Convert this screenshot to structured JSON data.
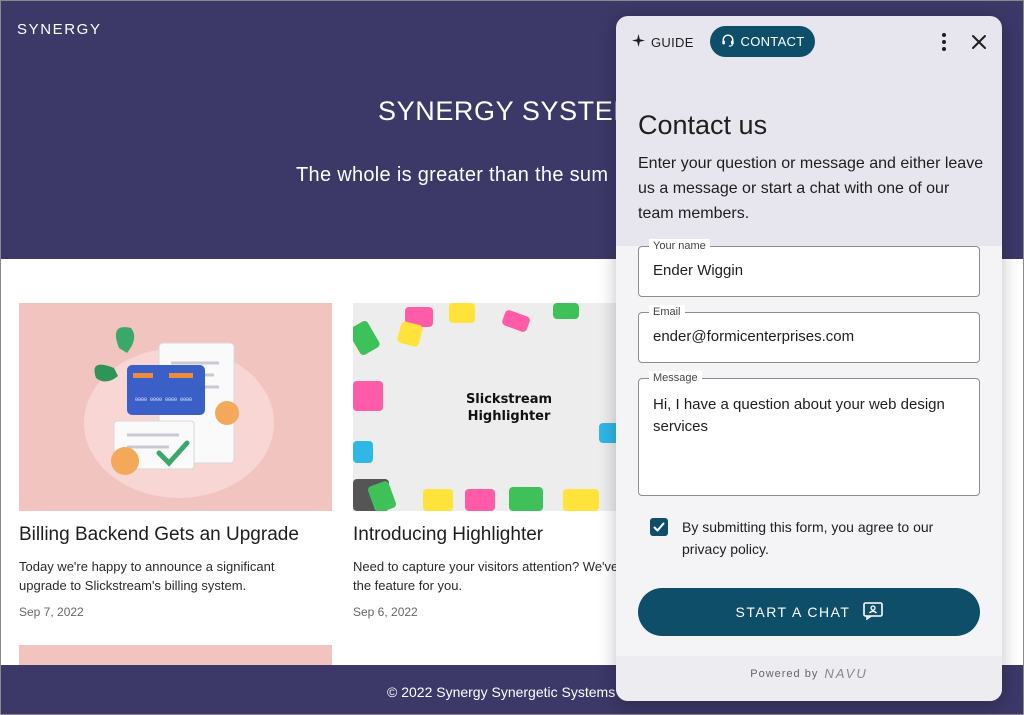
{
  "site": {
    "brand": "SYNERGY",
    "hero_title": "SYNERGY SYSTEMS",
    "hero_subtitle": "The whole is greater than the sum",
    "cards": [
      {
        "image_caption": "",
        "title": "Billing Backend Gets an Upgrade",
        "text_line1": "Today we're happy to announce a significant",
        "text_line2": "upgrade to Slickstream's billing system.",
        "date": "Sep 7, 2022"
      },
      {
        "image_caption": "Slickstream Highlighter",
        "title": "Introducing Highlighter",
        "text_line1": "Need to capture your visitors attention? We've",
        "text_line2": "the feature for you.",
        "date": "Sep 6, 2022"
      }
    ],
    "footer": "© 2022 Synergy Synergetic Systems"
  },
  "panel": {
    "tabs": {
      "guide": "GUIDE",
      "contact": "CONTACT"
    },
    "heading": "Contact us",
    "description": "Enter your question or message and either leave us a message or start a chat with one of our team members.",
    "fields": {
      "name": {
        "label": "Your name",
        "value": "Ender Wiggin"
      },
      "email": {
        "label": "Email",
        "value": "ender@formicenterprises.com"
      },
      "message": {
        "label": "Message",
        "value": "Hi, I have a question about your web design services"
      }
    },
    "consent": {
      "checked": true,
      "text": "By submitting this form, you agree to our privacy policy."
    },
    "start_button": "START A CHAT",
    "powered_by": "Powered by",
    "powered_logo": "NAVU"
  },
  "colors": {
    "hero_bg": "#3c3868",
    "accent": "#0e4e68",
    "card1_bg": "#f2c4c0",
    "card2_bg": "#ededed"
  },
  "icons": [
    "sparkle-icon",
    "headset-icon",
    "more-vertical-icon",
    "close-icon",
    "checkmark-icon",
    "chat-icon"
  ]
}
